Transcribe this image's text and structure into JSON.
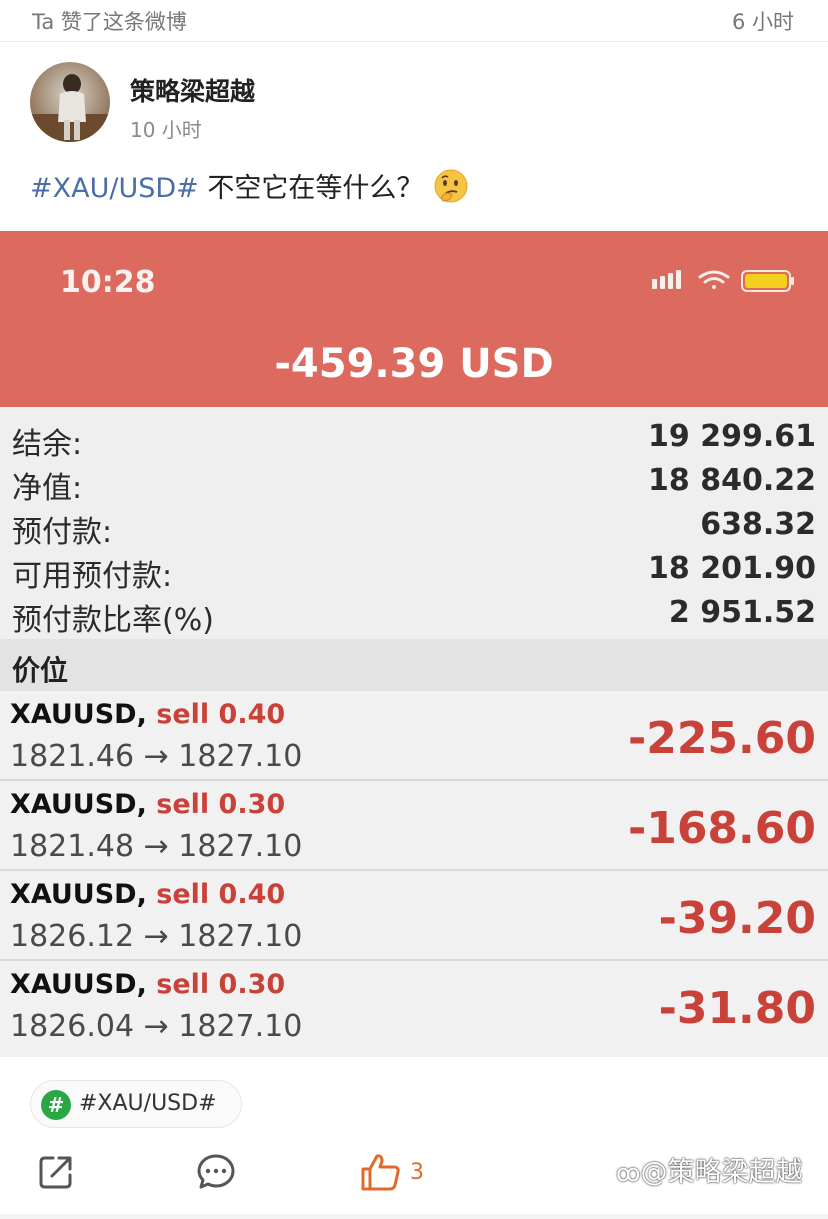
{
  "notice": {
    "text": "Ta 赞了这条微博",
    "time": "6 小时"
  },
  "author": {
    "name": "策略梁超越",
    "time": "10 小时"
  },
  "post": {
    "hashtag": "#XAU/USD#",
    "text": " 不空它在等什么？",
    "emoji": "thinking-face"
  },
  "screenshot": {
    "clock": "10:28",
    "floating_pl": "-459.39 USD",
    "summary": [
      {
        "label": "结余:",
        "value": "19 299.61"
      },
      {
        "label": "净值:",
        "value": "18 840.22"
      },
      {
        "label": "预付款:",
        "value": "638.32"
      },
      {
        "label": "可用预付款:",
        "value": "18 201.90"
      },
      {
        "label": "预付款比率(%)",
        "value": "2 951.52"
      }
    ],
    "section_title": "价位",
    "trades": [
      {
        "symbol": "XAUUSD,",
        "side": "sell 0.40",
        "prices": "1821.46 → 1827.10",
        "pnl": "-225.60"
      },
      {
        "symbol": "XAUUSD,",
        "side": "sell 0.30",
        "prices": "1821.48 → 1827.10",
        "pnl": "-168.60"
      },
      {
        "symbol": "XAUUSD,",
        "side": "sell 0.40",
        "prices": "1826.12 → 1827.10",
        "pnl": "-39.20"
      },
      {
        "symbol": "XAUUSD,",
        "side": "sell 0.30",
        "prices": "1826.04 → 1827.10",
        "pnl": "-31.80"
      }
    ],
    "colors": {
      "header": "#dc6a5f",
      "loss": "#c8423a"
    }
  },
  "topic": {
    "label": "#XAU/USD#"
  },
  "actions": {
    "like_count": "3"
  },
  "watermark": "@策略梁超越",
  "colors": {
    "link": "#4a6ea9",
    "like": "#e06a2c",
    "topic_badge": "#2aa745"
  }
}
